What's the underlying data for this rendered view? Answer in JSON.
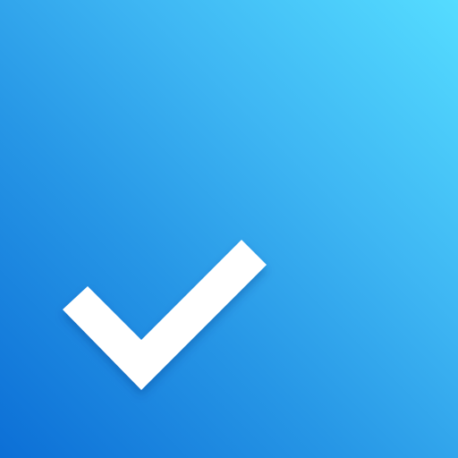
{
  "app_icon": {
    "icon": "checkmark-icon",
    "colors": {
      "gradient_light": "#55dcff",
      "gradient_mid": "#2797e6",
      "gradient_dark": "#0c6fd6",
      "checkmark": "#ffffff",
      "shadow": "#003c8c"
    }
  }
}
